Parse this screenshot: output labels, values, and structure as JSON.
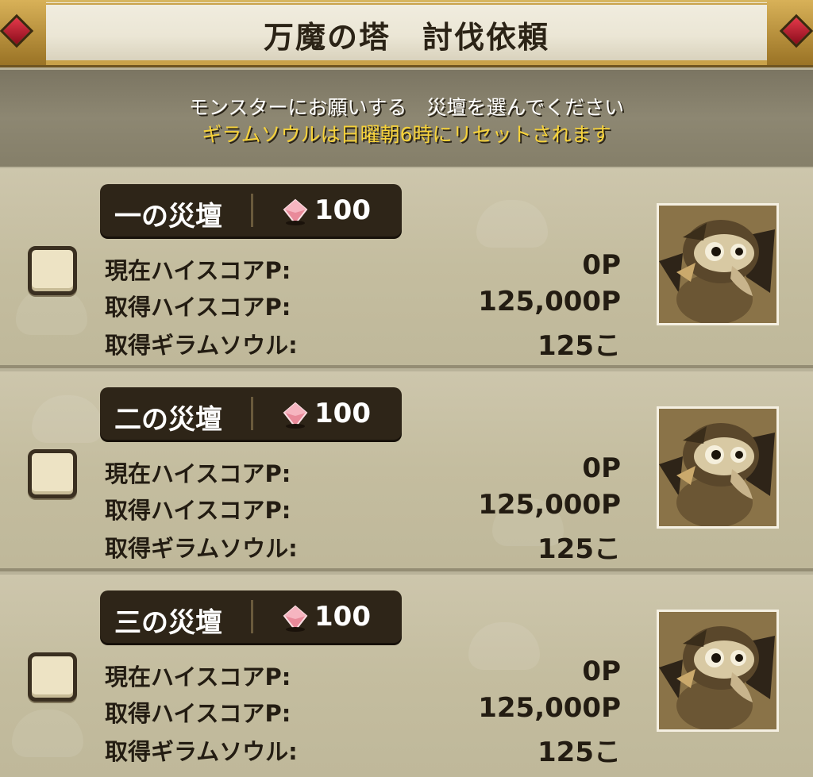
{
  "header": {
    "title": "万魔の塔　討伐依頼"
  },
  "notice": {
    "line1": "モンスターにお願いする　災壇を選んでください",
    "line2": "ギラムソウルは日曜朝6時にリセットされます"
  },
  "labels": {
    "current_score": "現在ハイスコアP:",
    "gained_score": "取得ハイスコアP:",
    "gained_soul": "取得ギラムソウル:"
  },
  "altars": [
    {
      "name": "一の災壇",
      "cost": "100",
      "current_score": "0P",
      "gained_score": "125,000P",
      "gained_soul": "125こ",
      "checked": false,
      "portrait_icon": "monster-portrait-icon"
    },
    {
      "name": "二の災壇",
      "cost": "100",
      "current_score": "0P",
      "gained_score": "125,000P",
      "gained_soul": "125こ",
      "checked": false,
      "portrait_icon": "monster-portrait-icon"
    },
    {
      "name": "三の災壇",
      "cost": "100",
      "current_score": "0P",
      "gained_score": "125,000P",
      "gained_soul": "125こ",
      "checked": false,
      "portrait_icon": "monster-portrait-icon"
    }
  ],
  "colors": {
    "gem": "#e07080",
    "notice_highlight": "#f6d23a",
    "accent_gold": "#c9a24a"
  }
}
